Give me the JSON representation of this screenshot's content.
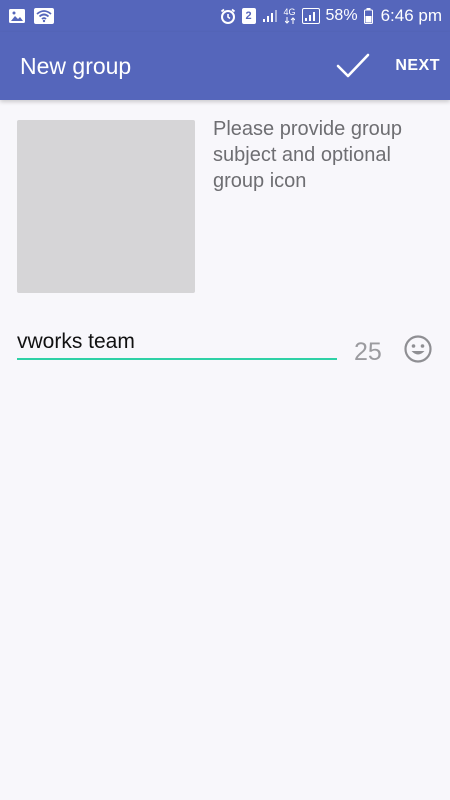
{
  "status_bar": {
    "sim_slot": "2",
    "network_type_top": "4G",
    "battery_percent": "58%",
    "time": "6:46 pm",
    "icons": [
      "image-icon",
      "wifi-icon",
      "alarm-icon",
      "signal-icon",
      "signal-icon",
      "battery-icon"
    ]
  },
  "app_bar": {
    "title": "New group",
    "confirm_icon": "check-icon",
    "next_label": "NEXT"
  },
  "form": {
    "hint": "Please provide group subject and optional group icon",
    "subject_value": "vworks team",
    "char_count": "25",
    "emoji_icon": "smiley-icon"
  },
  "colors": {
    "toolbar": "#5566bb",
    "underline_accent": "#2fd1a6",
    "background": "#f8f7fb",
    "icon_placeholder": "#d6d5d7"
  }
}
